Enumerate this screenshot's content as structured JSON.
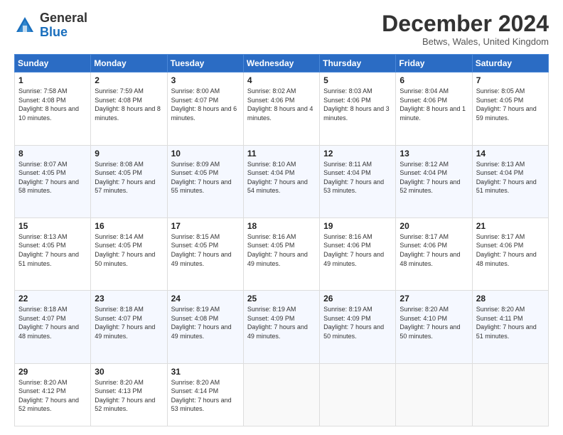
{
  "header": {
    "logo_general": "General",
    "logo_blue": "Blue",
    "month_title": "December 2024",
    "location": "Betws, Wales, United Kingdom"
  },
  "days_of_week": [
    "Sunday",
    "Monday",
    "Tuesday",
    "Wednesday",
    "Thursday",
    "Friday",
    "Saturday"
  ],
  "weeks": [
    [
      {
        "day": "1",
        "sunrise": "7:58 AM",
        "sunset": "4:08 PM",
        "daylight": "8 hours and 10 minutes."
      },
      {
        "day": "2",
        "sunrise": "7:59 AM",
        "sunset": "4:08 PM",
        "daylight": "8 hours and 8 minutes."
      },
      {
        "day": "3",
        "sunrise": "8:00 AM",
        "sunset": "4:07 PM",
        "daylight": "8 hours and 6 minutes."
      },
      {
        "day": "4",
        "sunrise": "8:02 AM",
        "sunset": "4:06 PM",
        "daylight": "8 hours and 4 minutes."
      },
      {
        "day": "5",
        "sunrise": "8:03 AM",
        "sunset": "4:06 PM",
        "daylight": "8 hours and 3 minutes."
      },
      {
        "day": "6",
        "sunrise": "8:04 AM",
        "sunset": "4:06 PM",
        "daylight": "8 hours and 1 minute."
      },
      {
        "day": "7",
        "sunrise": "8:05 AM",
        "sunset": "4:05 PM",
        "daylight": "7 hours and 59 minutes."
      }
    ],
    [
      {
        "day": "8",
        "sunrise": "8:07 AM",
        "sunset": "4:05 PM",
        "daylight": "7 hours and 58 minutes."
      },
      {
        "day": "9",
        "sunrise": "8:08 AM",
        "sunset": "4:05 PM",
        "daylight": "7 hours and 57 minutes."
      },
      {
        "day": "10",
        "sunrise": "8:09 AM",
        "sunset": "4:05 PM",
        "daylight": "7 hours and 55 minutes."
      },
      {
        "day": "11",
        "sunrise": "8:10 AM",
        "sunset": "4:04 PM",
        "daylight": "7 hours and 54 minutes."
      },
      {
        "day": "12",
        "sunrise": "8:11 AM",
        "sunset": "4:04 PM",
        "daylight": "7 hours and 53 minutes."
      },
      {
        "day": "13",
        "sunrise": "8:12 AM",
        "sunset": "4:04 PM",
        "daylight": "7 hours and 52 minutes."
      },
      {
        "day": "14",
        "sunrise": "8:13 AM",
        "sunset": "4:04 PM",
        "daylight": "7 hours and 51 minutes."
      }
    ],
    [
      {
        "day": "15",
        "sunrise": "8:13 AM",
        "sunset": "4:05 PM",
        "daylight": "7 hours and 51 minutes."
      },
      {
        "day": "16",
        "sunrise": "8:14 AM",
        "sunset": "4:05 PM",
        "daylight": "7 hours and 50 minutes."
      },
      {
        "day": "17",
        "sunrise": "8:15 AM",
        "sunset": "4:05 PM",
        "daylight": "7 hours and 49 minutes."
      },
      {
        "day": "18",
        "sunrise": "8:16 AM",
        "sunset": "4:05 PM",
        "daylight": "7 hours and 49 minutes."
      },
      {
        "day": "19",
        "sunrise": "8:16 AM",
        "sunset": "4:06 PM",
        "daylight": "7 hours and 49 minutes."
      },
      {
        "day": "20",
        "sunrise": "8:17 AM",
        "sunset": "4:06 PM",
        "daylight": "7 hours and 48 minutes."
      },
      {
        "day": "21",
        "sunrise": "8:17 AM",
        "sunset": "4:06 PM",
        "daylight": "7 hours and 48 minutes."
      }
    ],
    [
      {
        "day": "22",
        "sunrise": "8:18 AM",
        "sunset": "4:07 PM",
        "daylight": "7 hours and 48 minutes."
      },
      {
        "day": "23",
        "sunrise": "8:18 AM",
        "sunset": "4:07 PM",
        "daylight": "7 hours and 49 minutes."
      },
      {
        "day": "24",
        "sunrise": "8:19 AM",
        "sunset": "4:08 PM",
        "daylight": "7 hours and 49 minutes."
      },
      {
        "day": "25",
        "sunrise": "8:19 AM",
        "sunset": "4:09 PM",
        "daylight": "7 hours and 49 minutes."
      },
      {
        "day": "26",
        "sunrise": "8:19 AM",
        "sunset": "4:09 PM",
        "daylight": "7 hours and 50 minutes."
      },
      {
        "day": "27",
        "sunrise": "8:20 AM",
        "sunset": "4:10 PM",
        "daylight": "7 hours and 50 minutes."
      },
      {
        "day": "28",
        "sunrise": "8:20 AM",
        "sunset": "4:11 PM",
        "daylight": "7 hours and 51 minutes."
      }
    ],
    [
      {
        "day": "29",
        "sunrise": "8:20 AM",
        "sunset": "4:12 PM",
        "daylight": "7 hours and 52 minutes."
      },
      {
        "day": "30",
        "sunrise": "8:20 AM",
        "sunset": "4:13 PM",
        "daylight": "7 hours and 52 minutes."
      },
      {
        "day": "31",
        "sunrise": "8:20 AM",
        "sunset": "4:14 PM",
        "daylight": "7 hours and 53 minutes."
      },
      null,
      null,
      null,
      null
    ]
  ]
}
